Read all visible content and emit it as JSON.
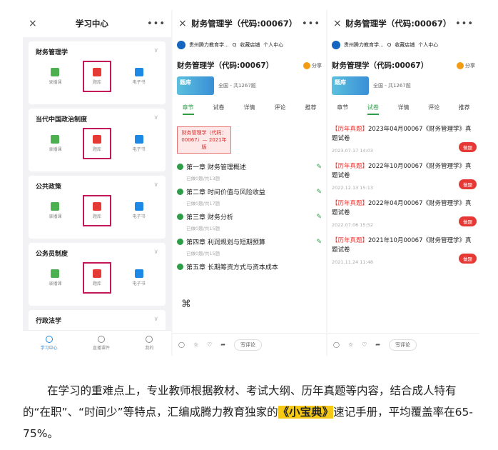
{
  "panel1": {
    "close": "×",
    "title": "学习中心",
    "more": "•••",
    "cards": [
      {
        "name": "财务管理学",
        "chev": "∨",
        "items": [
          "录播课",
          "题库",
          "电子书"
        ]
      },
      {
        "name": "当代中国政治制度",
        "chev": "∨",
        "items": [
          "录播课",
          "题库",
          "电子书"
        ]
      },
      {
        "name": "公共政策",
        "chev": "∨",
        "items": [
          "录播课",
          "题库",
          "电子书"
        ]
      },
      {
        "name": "公务员制度",
        "chev": "∨",
        "items": [
          "录播课",
          "题库",
          "电子书"
        ]
      },
      {
        "name": "行政法学",
        "chev": "∨",
        "items": []
      }
    ],
    "nav": [
      "学习中心",
      "直播课件",
      "我的"
    ]
  },
  "panel2": {
    "close": "×",
    "title": "财务管理学（代码:00067）",
    "more": "•••",
    "store": {
      "name": "贵州腾力教育学...",
      "search": "Q",
      "fav": "收藏店铺",
      "me": "个人中心"
    },
    "page_title": "财务管理学（代码:00067）",
    "share": "分享",
    "bank": {
      "label": "题库",
      "desc": "全国 - 共1267题"
    },
    "tabs": [
      "章节",
      "试卷",
      "详情",
      "评论",
      "推荐"
    ],
    "badge": "财务管理学（代码：00067）— 2021年版",
    "chapters": [
      {
        "name": "第一章 财务管理概述",
        "sub": "已做0题/共13题"
      },
      {
        "name": "第二章 时间价值与风险收益",
        "sub": "已做0题/共17题"
      },
      {
        "name": "第三章 财务分析",
        "sub": "已做0题/共15题"
      },
      {
        "name": "第四章 利润规划与短期预算",
        "sub": "已做0题/共15题"
      },
      {
        "name": "第五章 长期筹资方式与资本成本",
        "sub": ""
      }
    ],
    "write": "写评论"
  },
  "panel3": {
    "close": "×",
    "title": "财务管理学（代码:00067）",
    "more": "•••",
    "store": {
      "name": "贵州腾力教育学...",
      "search": "Q",
      "fav": "收藏店铺",
      "me": "个人中心"
    },
    "page_title": "财务管理学（代码:00067）",
    "share": "分享",
    "bank": {
      "label": "题库",
      "desc": "全国 - 共1267题"
    },
    "tabs": [
      "章节",
      "试卷",
      "详情",
      "评论",
      "推荐"
    ],
    "exams": [
      {
        "tag": "【历年真题】",
        "text": "2023年04月00067《财务管理学》真题试卷",
        "date": "2023.07.17 14:03",
        "btn": "做题"
      },
      {
        "tag": "【历年真题】",
        "text": "2022年10月00067《财务管理学》真题试卷",
        "date": "2022.12.13 15:13",
        "btn": "做题"
      },
      {
        "tag": "【历年真题】",
        "text": "2022年04月00067《财务管理学》真题试卷",
        "date": "2022.07.06 15:52",
        "btn": "做题"
      },
      {
        "tag": "【历年真题】",
        "text": "2021年10月00067《财务管理学》真题试卷",
        "date": "2021.11.24 11:48",
        "btn": "做题"
      }
    ],
    "write": "写评论"
  },
  "paragraph": {
    "before": "在学习的重难点上，专业教师根据教材、考试大纲、历年真题等内容，结合成人特有的“在职”、“时间少”等特点，汇编成腾力教育独家的",
    "highlight": "《小宝典》",
    "after": "速记手册，平均覆盖率在65-75%。"
  }
}
